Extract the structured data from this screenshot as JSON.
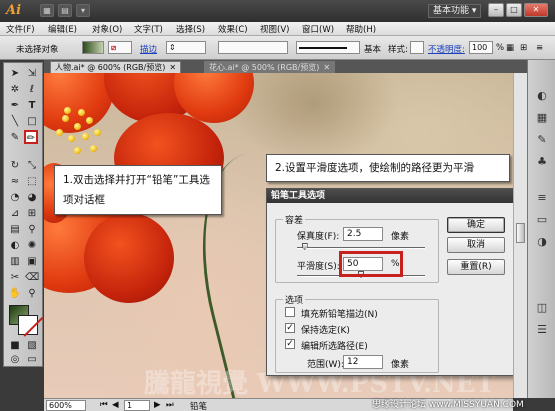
{
  "titlebar": {
    "app_name": "Ai",
    "workspace": "基本功能",
    "workspace_arrow": "▾",
    "min": "–",
    "max": "□",
    "close": "✕"
  },
  "menu": [
    "文件(F)",
    "编辑(E)",
    "对象(O)",
    "文字(T)",
    "选择(S)",
    "效果(C)",
    "视图(V)",
    "窗口(W)",
    "帮助(H)"
  ],
  "control": {
    "selection": "未选择对象",
    "stroke_label": "描边",
    "basic": "基本",
    "style_label": "样式:",
    "opacity_label": "不透明度:",
    "opacity_value": "100",
    "opacity_unit": "%"
  },
  "tabs": [
    {
      "label": "人物.ai* @ 600% (RGB/预览)",
      "close": "✕"
    },
    {
      "label": "花心.ai* @ 500% (RGB/预览)",
      "close": "✕"
    }
  ],
  "callouts": {
    "step1": "1.双击选择并打开“铅笔”工具选项对话框",
    "step2": "2.设置平滑度选项，使绘制的路径更为平滑"
  },
  "dialog": {
    "title": "铅笔工具选项",
    "tolerance_group": "容差",
    "fidelity_label": "保真度(F):",
    "fidelity_value": "2.5",
    "fidelity_unit": "像素",
    "fidelity_slider": 0.06,
    "smoothness_label": "平滑度(S):",
    "smoothness_value": "50",
    "smoothness_unit": "%",
    "smoothness_slider": 0.5,
    "ok": "确定",
    "cancel": "取消",
    "reset": "重置(R)",
    "options_group": "选项",
    "opt_fill": "填充新铅笔描边(N)",
    "opt_fill_checked": false,
    "opt_keep": "保持选定(K)",
    "opt_keep_checked": true,
    "opt_edit": "编辑所选路径(E)",
    "opt_edit_checked": true,
    "range_label": "范围(W):",
    "range_value": "12",
    "range_unit": "像素"
  },
  "statusbar": {
    "zoom": "600%",
    "page": "1",
    "tool": "铅笔"
  },
  "watermark": "騰龍視覺 WWW.PSTV.NET",
  "site_mark": "思缘设计论坛 www.MISSYUAN.COM"
}
